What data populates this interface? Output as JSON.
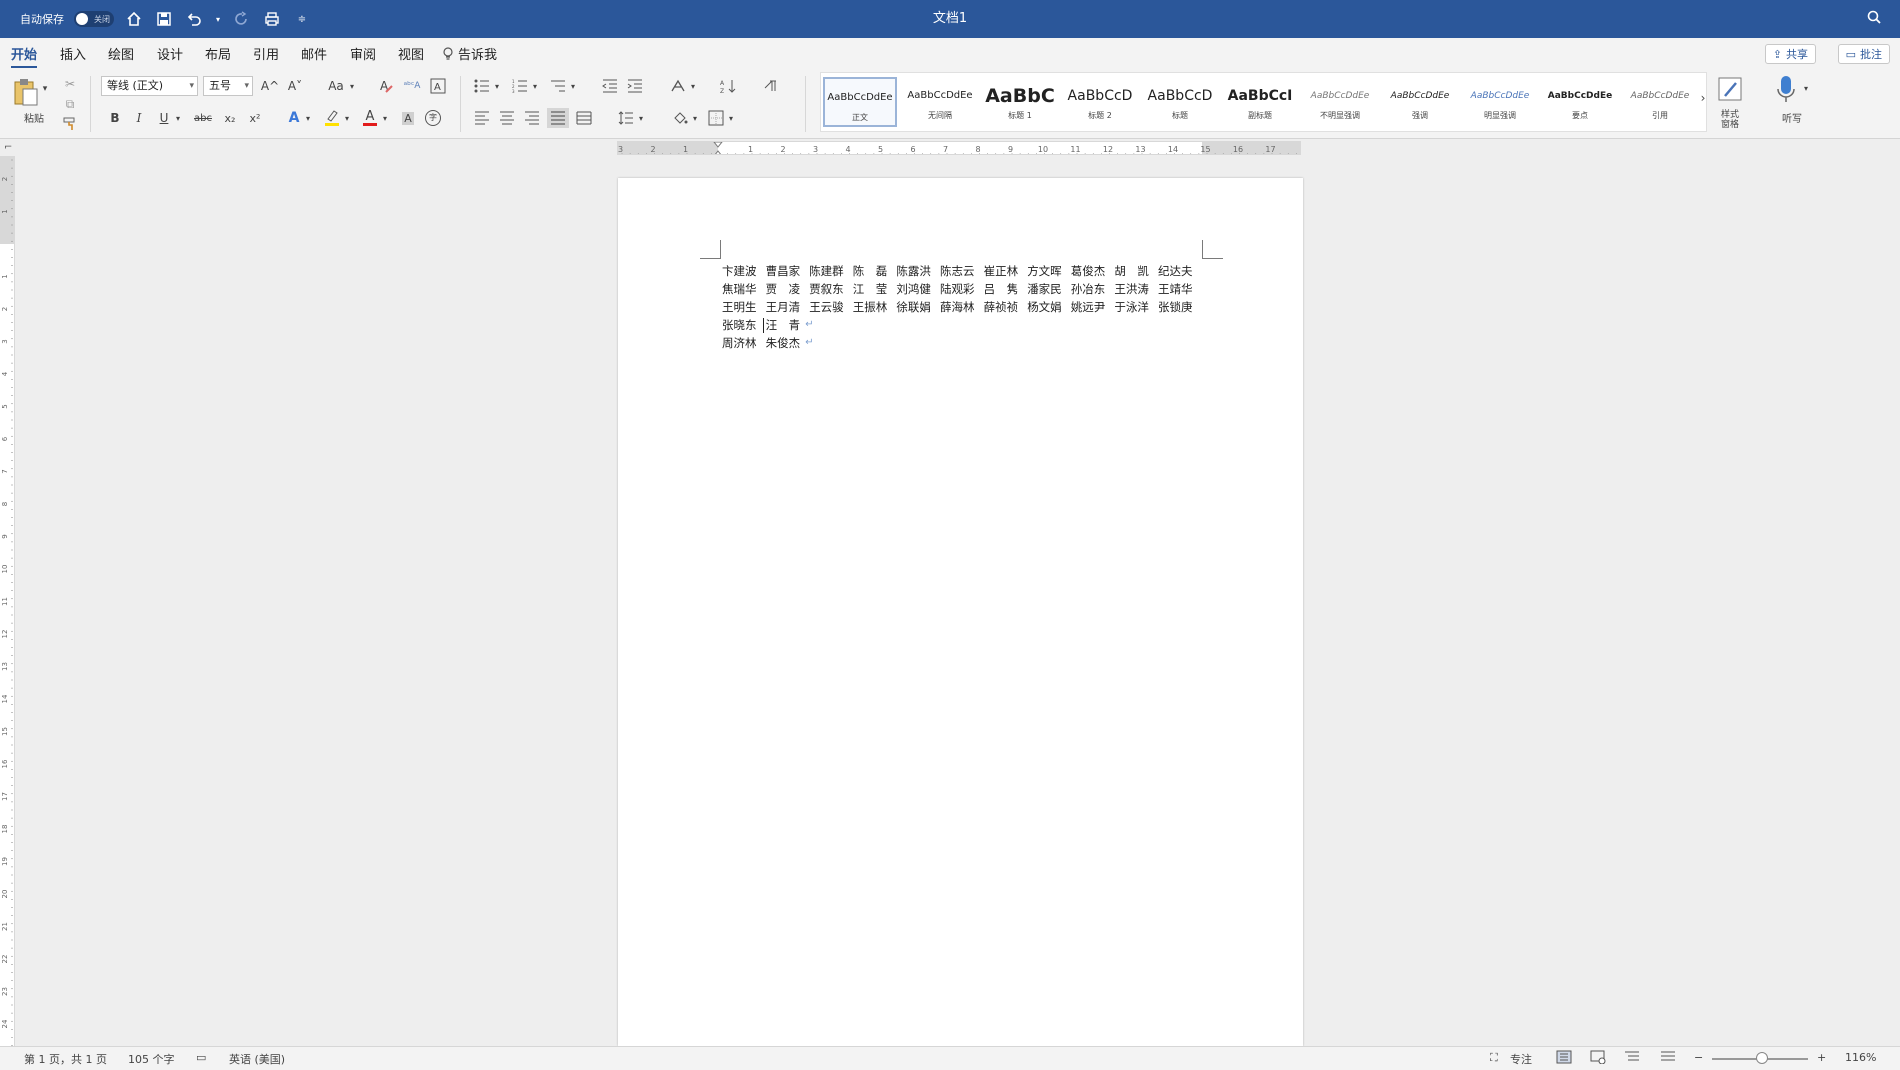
{
  "titlebar": {
    "autosave_label": "自动保存",
    "autosave_state": "关闭",
    "doc_title": "文档1"
  },
  "tabs": [
    {
      "label": "开始",
      "active": true
    },
    {
      "label": "插入"
    },
    {
      "label": "绘图"
    },
    {
      "label": "设计"
    },
    {
      "label": "布局"
    },
    {
      "label": "引用"
    },
    {
      "label": "邮件"
    },
    {
      "label": "审阅"
    },
    {
      "label": "视图"
    },
    {
      "label": "告诉我"
    }
  ],
  "tab_right": {
    "share": "共享",
    "comments": "批注"
  },
  "ribbon": {
    "paste_label": "粘贴",
    "font_name": "等线 (正文)",
    "font_size": "五号",
    "grow_font": "A^",
    "shrink_font": "A˅",
    "change_case": "Aa",
    "bold": "B",
    "italic": "I",
    "underline": "U",
    "strike": "abc",
    "subscript": "x₂",
    "superscript": "x²",
    "text_effects": "A",
    "font_color": "A",
    "char_shading": "A",
    "enclose": "字",
    "styles_pane": "样式\n窗格",
    "dictate": "听写",
    "colors": {
      "accent": "#2b579a",
      "highlight": "#ffe100",
      "font_red": "#e21b1b"
    }
  },
  "styles": [
    {
      "preview": "AaBbCcDdEe",
      "name": "正文",
      "selected": true
    },
    {
      "preview": "AaBbCcDdEe",
      "name": "无间隔"
    },
    {
      "preview": "AaBbC",
      "name": "标题 1"
    },
    {
      "preview": "AaBbCcD",
      "name": "标题 2"
    },
    {
      "preview": "AaBbCcD",
      "name": "标题"
    },
    {
      "preview": "AaBbCcI",
      "name": "副标题"
    },
    {
      "preview": "AaBbCcDdEe",
      "name": "不明显强调"
    },
    {
      "preview": "AaBbCcDdEe",
      "name": "强调"
    },
    {
      "preview": "AaBbCcDdEe",
      "name": "明显强调"
    },
    {
      "preview": "AaBbCcDdEe",
      "name": "要点"
    },
    {
      "preview": "AaBbCcDdEe",
      "name": "引用"
    }
  ],
  "ruler": {
    "h_labels": [
      "3",
      "2",
      "1",
      "1",
      "2",
      "3",
      "4",
      "5",
      "6",
      "7",
      "8",
      "9",
      "10",
      "11",
      "12",
      "13",
      "14",
      "15",
      "16",
      "17"
    ],
    "v_labels": [
      "2",
      "1",
      "1",
      "2",
      "3",
      "4",
      "5",
      "6",
      "7",
      "8",
      "9",
      "10",
      "11",
      "12",
      "13",
      "14",
      "15",
      "16",
      "17",
      "18",
      "19",
      "20",
      "21",
      "22",
      "23",
      "24"
    ]
  },
  "document": {
    "rows": [
      [
        "卞建波",
        "曹昌家",
        "陈建群",
        "陈　磊",
        "陈露洪",
        "陈志云",
        "崔正林",
        "方文晖",
        "葛俊杰",
        "胡　凯",
        "纪达夫"
      ],
      [
        "焦瑞华",
        "贾　凌",
        "贾叙东",
        "江　莹",
        "刘鸿健",
        "陆观彩",
        "吕　隽",
        "潘家民",
        "孙冶东",
        "王洪涛",
        "王靖华"
      ],
      [
        "王明生",
        "王月清",
        "王云骏",
        "王振林",
        "徐联娟",
        "薛海林",
        "薛祯祯",
        "杨文娟",
        "姚远尹",
        "于泳洋",
        "张锁庚"
      ],
      [
        "张晓东",
        "汪　青"
      ],
      [
        "周济林",
        "朱俊杰"
      ]
    ],
    "paragraph_mark": "↵"
  },
  "status": {
    "page_info": "第 1 页，共 1 页",
    "word_count": "105 个字",
    "language": "英语 (美国)",
    "focus": "专注",
    "zoom": "116%",
    "zoom_minus": "−",
    "zoom_plus": "+"
  }
}
